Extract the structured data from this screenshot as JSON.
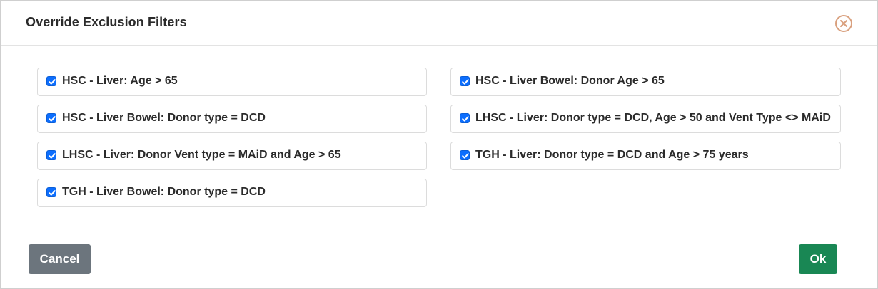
{
  "dialog": {
    "title": "Override Exclusion Filters",
    "close_icon": "circle-x-icon"
  },
  "filters": {
    "left": [
      {
        "label": "HSC - Liver: Age > 65",
        "checked": true
      },
      {
        "label": "HSC - Liver Bowel: Donor type = DCD",
        "checked": true
      },
      {
        "label": "LHSC - Liver: Donor Vent type = MAiD and Age > 65",
        "checked": true
      },
      {
        "label": "TGH - Liver Bowel: Donor type = DCD",
        "checked": true
      }
    ],
    "right": [
      {
        "label": "HSC - Liver Bowel: Donor Age > 65",
        "checked": true
      },
      {
        "label": "LHSC - Liver: Donor type = DCD, Age > 50 and Vent Type <> MAiD",
        "checked": true
      },
      {
        "label": "TGH - Liver: Donor type = DCD and Age > 75 years",
        "checked": true
      }
    ]
  },
  "footer": {
    "cancel_label": "Cancel",
    "ok_label": "Ok"
  },
  "colors": {
    "checkbox": "#0d6efd",
    "cancel_button": "#6c757d",
    "ok_button": "#198754",
    "close_icon": "#d9a07e"
  }
}
